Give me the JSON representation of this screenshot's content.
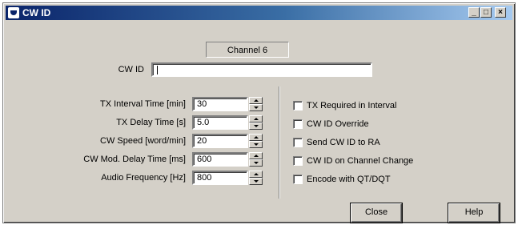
{
  "window": {
    "title": "CW ID",
    "minimize_glyph": "_",
    "maximize_glyph": "□",
    "close_glyph": "×"
  },
  "channel_label": "Channel 6",
  "cwid": {
    "label": "CW ID",
    "value": ""
  },
  "fields": [
    {
      "label": "TX Interval Time [min]",
      "value": "30"
    },
    {
      "label": "TX Delay Time [s]",
      "value": "5.0"
    },
    {
      "label": "CW Speed [word/min]",
      "value": "20"
    },
    {
      "label": "CW Mod. Delay Time [ms]",
      "value": "600"
    },
    {
      "label": "Audio Frequency [Hz]",
      "value": "800"
    }
  ],
  "checkboxes": [
    {
      "label": "TX Required in Interval",
      "checked": false
    },
    {
      "label": "CW ID Override",
      "checked": false
    },
    {
      "label": "Send CW ID to RA",
      "checked": false
    },
    {
      "label": "CW ID on Channel Change",
      "checked": false
    },
    {
      "label": "Encode with QT/DQT",
      "checked": false
    }
  ],
  "buttons": {
    "close": "Close",
    "help": "Help"
  },
  "colors": {
    "titlebar_start": "#0a246a",
    "face": "#d4d0c8"
  }
}
